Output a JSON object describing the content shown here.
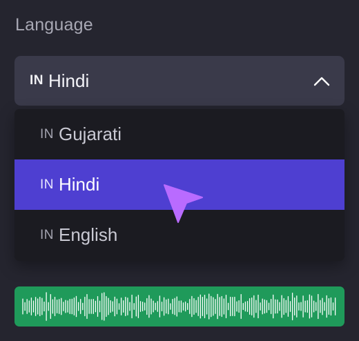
{
  "language_section": {
    "label": "Language"
  },
  "select": {
    "selected_code": "IN",
    "selected_label": "Hindi",
    "expanded": true,
    "chevron_icon": "chevron-up-icon"
  },
  "options": [
    {
      "code": "IN",
      "label": "Gujarati",
      "selected": false
    },
    {
      "code": "IN",
      "label": "Hindi",
      "selected": true
    },
    {
      "code": "IN",
      "label": "English",
      "selected": false
    }
  ],
  "cursor": {
    "icon": "pointer-arrow-icon",
    "color": "#b96bff"
  },
  "audio": {
    "icon": "waveform-icon",
    "background": "#1f9a5a",
    "bar_color": "#ffffff"
  },
  "colors": {
    "background": "#25252f",
    "trigger": "#3a3a4a",
    "dropdown": "#1b1b21",
    "selected_option": "#4e3fd1"
  }
}
